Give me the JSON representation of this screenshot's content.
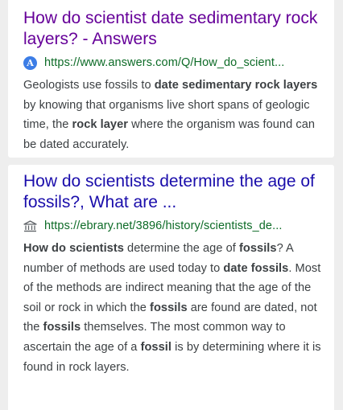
{
  "results": [
    {
      "title": "How do scientist date sedimentary rock layers? - Answers",
      "url": "https://www.answers.com/Q/How_do_scient...",
      "site_icon": "answers-logo-icon",
      "snippet": [
        {
          "text": "Geologists use fossils to ",
          "bold": false
        },
        {
          "text": "date sedimentary rock layers",
          "bold": true
        },
        {
          "text": " by knowing that organisms live short spans of geologic time, the ",
          "bold": false
        },
        {
          "text": "rock layer",
          "bold": true
        },
        {
          "text": " where the organism was found can be dated accurately.",
          "bold": false
        }
      ]
    },
    {
      "title": "How do scientists determine the age of fossils?, What are ...",
      "url": "https://ebrary.net/3896/history/scientists_de...",
      "site_icon": "library-building-icon",
      "snippet": [
        {
          "text": "How do scientists",
          "bold": true
        },
        {
          "text": " determine the age of ",
          "bold": false
        },
        {
          "text": "fossils",
          "bold": true
        },
        {
          "text": "? A number of methods are used today to ",
          "bold": false
        },
        {
          "text": "date fossils",
          "bold": true
        },
        {
          "text": ". Most of the methods are indirect meaning that the age of the soil or rock in which the ",
          "bold": false
        },
        {
          "text": "fossils",
          "bold": true
        },
        {
          "text": " are found are dated, not the ",
          "bold": false
        },
        {
          "text": "fossils",
          "bold": true
        },
        {
          "text": " themselves. The most common way to ascertain the age of a ",
          "bold": false
        },
        {
          "text": "fossil",
          "bold": true
        },
        {
          "text": " is by determining where it is found in rock layers.",
          "bold": false
        }
      ]
    }
  ],
  "colors": {
    "visited_link": "#660099",
    "link": "#1a0dab",
    "url": "#0d6b27",
    "snippet": "#3c4043",
    "background": "#eeeeee"
  }
}
